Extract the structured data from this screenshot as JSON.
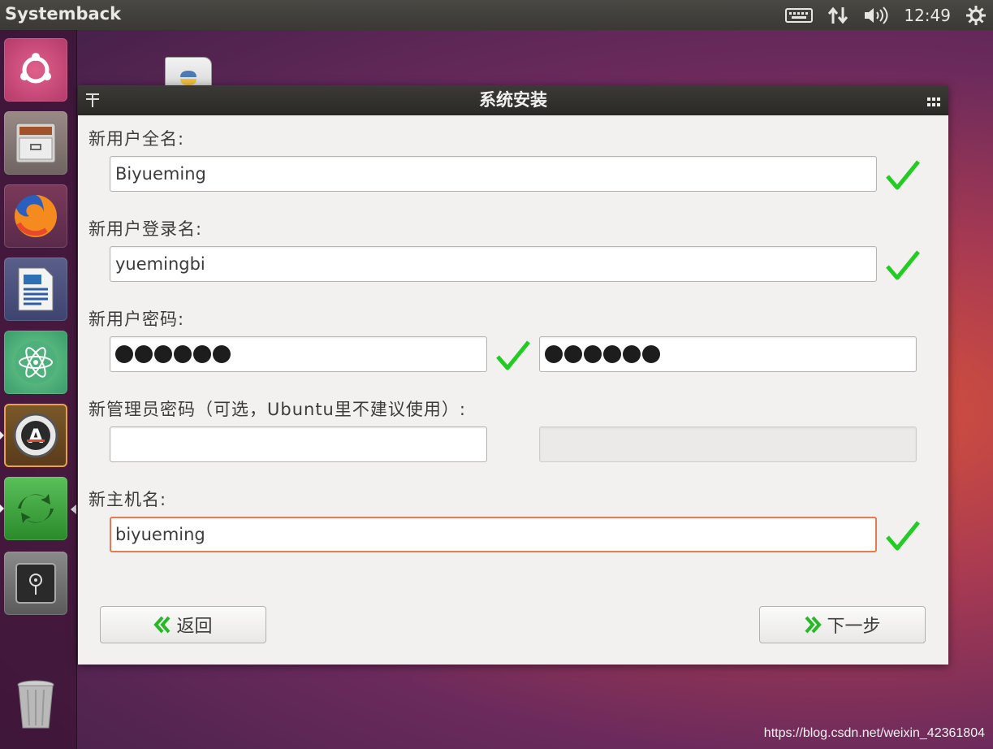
{
  "top_panel": {
    "app_title": "Systemback",
    "clock": "12:49",
    "tray_icons": [
      "keyboard-icon",
      "network-icon",
      "volume-icon",
      "settings-gear-icon"
    ]
  },
  "launcher": {
    "items": [
      "ubuntu-dash-icon",
      "file-cabinet-icon",
      "firefox-icon",
      "writer-document-icon",
      "atom-icon",
      "software-updater-icon",
      "systemback-icon",
      "safe-icon",
      "trash-icon"
    ]
  },
  "dialog": {
    "title": "系统安装",
    "fullname": {
      "label": "新用户全名:",
      "value": "Biyueming"
    },
    "username": {
      "label": "新用户登录名:",
      "value": "yuemingbi"
    },
    "password": {
      "label": "新用户密码:",
      "count": 6,
      "confirm_count": 6
    },
    "root_password": {
      "label": "新管理员密码（可选，Ubuntu里不建议使用）:",
      "value": "",
      "confirm_value": ""
    },
    "hostname": {
      "label": "新主机名:",
      "value": "biyueming"
    },
    "back_button": "返回",
    "next_button": "下一步",
    "accent_color": "#e07d54",
    "check_color": "#22cc22"
  },
  "watermark": "https://blog.csdn.net/weixin_42361804"
}
